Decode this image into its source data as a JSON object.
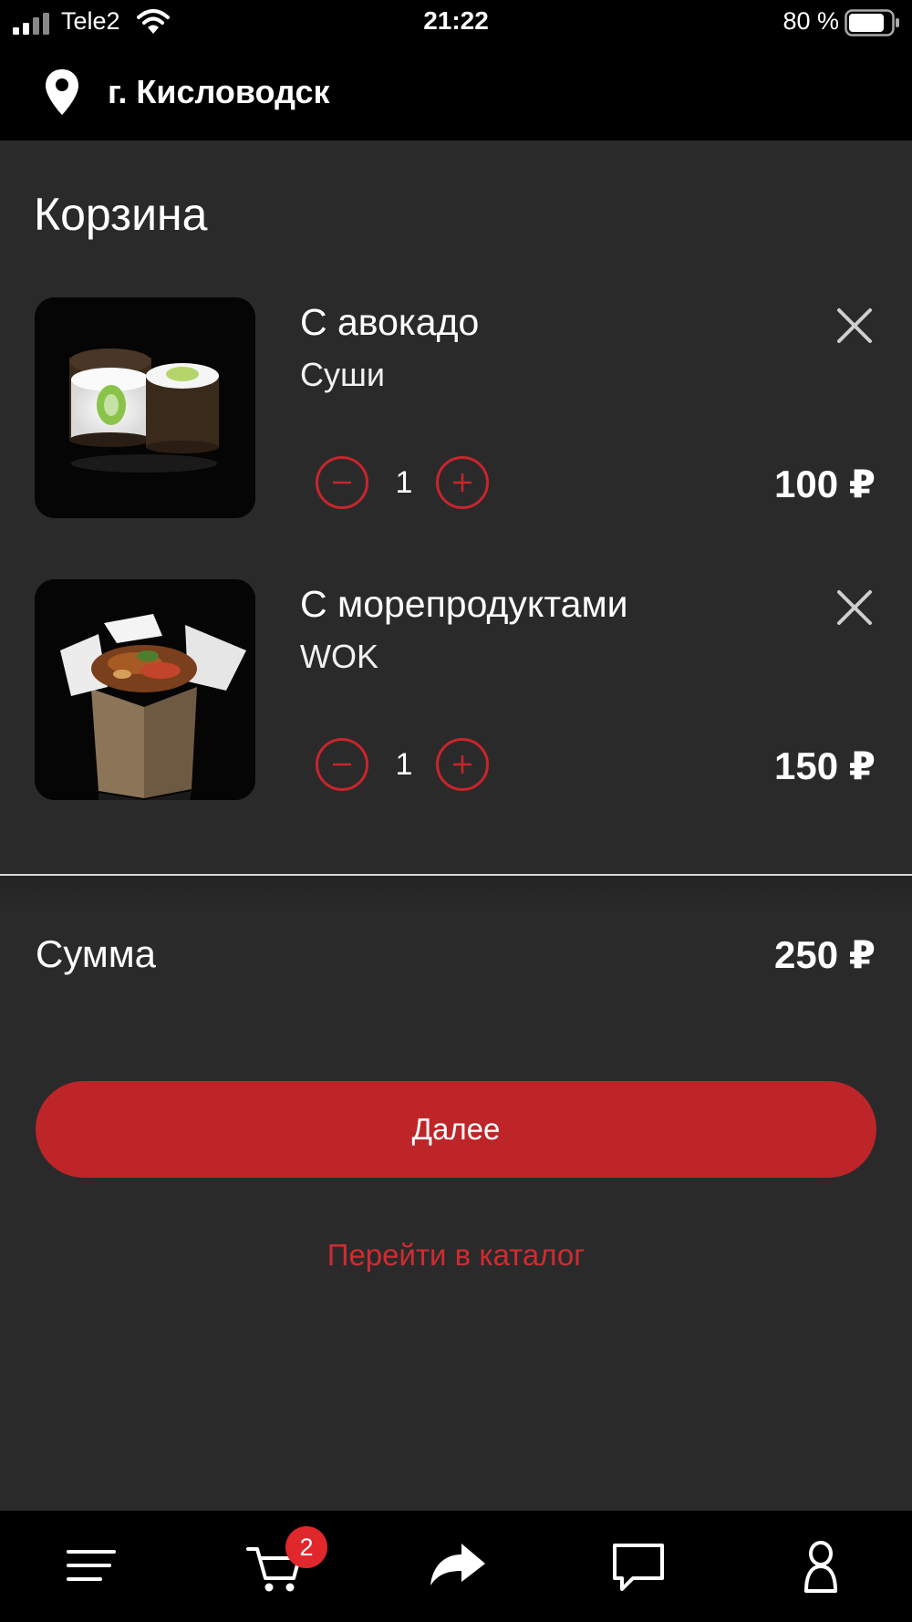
{
  "status_bar": {
    "carrier": "Tele2",
    "time": "21:22",
    "battery": "80 %"
  },
  "header": {
    "city": "г. Кисловодск",
    "icon": "location-pin-icon"
  },
  "page": {
    "title": "Корзина"
  },
  "cart": {
    "items": [
      {
        "name": "С авокадо",
        "category": "Суши",
        "quantity": "1",
        "price": "100 ₽",
        "image": "sushi-avocado-rolls"
      },
      {
        "name": "С морепродуктами",
        "category": "WOK",
        "quantity": "1",
        "price": "150 ₽",
        "image": "wok-seafood-box"
      }
    ]
  },
  "summary": {
    "label": "Сумма",
    "value": "250 ₽"
  },
  "actions": {
    "next": "Далее",
    "catalog": "Перейти в каталог"
  },
  "tabbar": {
    "cart_badge": "2",
    "icons": [
      "menu-icon",
      "cart-icon",
      "share-icon",
      "chat-icon",
      "profile-icon"
    ]
  },
  "colors": {
    "background": "#2a2a2b",
    "bars": "#000000",
    "accent": "#be2528",
    "badge": "#e0272c"
  }
}
